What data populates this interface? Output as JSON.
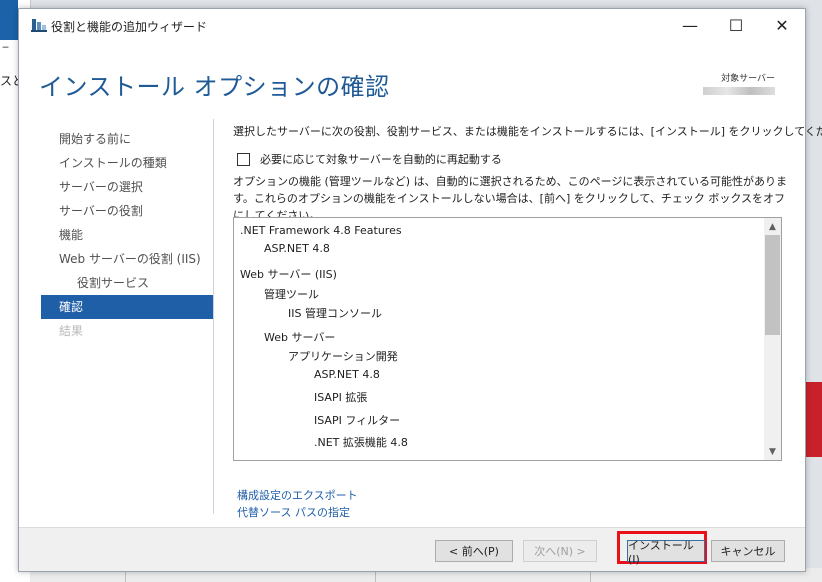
{
  "window": {
    "title": "役割と機能の追加ウィザード",
    "minimize": "—",
    "maximize": "☐",
    "close": "✕"
  },
  "background": {
    "left_fragment": "スと",
    "left_fragment2": "‒"
  },
  "header": {
    "title": "インストール オプションの確認",
    "target_server_label": "対象サーバー"
  },
  "nav": {
    "items": [
      {
        "label": "開始する前に",
        "state": "normal"
      },
      {
        "label": "インストールの種類",
        "state": "normal"
      },
      {
        "label": "サーバーの選択",
        "state": "normal"
      },
      {
        "label": "サーバーの役割",
        "state": "normal"
      },
      {
        "label": "機能",
        "state": "normal"
      },
      {
        "label": "Web サーバーの役割 (IIS)",
        "state": "normal"
      },
      {
        "label": "役割サービス",
        "state": "sub"
      },
      {
        "label": "確認",
        "state": "active"
      },
      {
        "label": "結果",
        "state": "disabled"
      }
    ]
  },
  "content": {
    "intro": "選択したサーバーに次の役割、役割サービス、または機能をインストールするには、[インストール] をクリックしてください。",
    "restart_label": "必要に応じて対象サーバーを自動的に再起動する",
    "optional_note": "オプションの機能 (管理ツールなど) は、自動的に選択されるため、このページに表示されている可能性があります。これらのオプションの機能をインストールしない場合は、[前へ] をクリックして、チェック ボックスをオフにしてください。",
    "features": [
      {
        "label": ".NET Framework 4.8 Features",
        "level": 0
      },
      {
        "label": "ASP.NET 4.8",
        "level": 1
      },
      {
        "label": "Web サーバー (IIS)",
        "level": 0
      },
      {
        "label": "管理ツール",
        "level": 1
      },
      {
        "label": "IIS 管理コンソール",
        "level": 2
      },
      {
        "label": "Web サーバー",
        "level": 1
      },
      {
        "label": "アプリケーション開発",
        "level": 2
      },
      {
        "label": "ASP.NET 4.8",
        "level": 3
      },
      {
        "label": "ISAPI 拡張",
        "level": 3
      },
      {
        "label": "ISAPI フィルター",
        "level": 3
      },
      {
        "label": ".NET 拡張機能 4.8",
        "level": 3
      }
    ],
    "export_link": "構成設定のエクスポート",
    "alt_source_link": "代替ソース パスの指定"
  },
  "footer": {
    "prev": "< 前へ(P)",
    "next": "次へ(N) >",
    "install": "インストール(I)",
    "cancel": "キャンセル"
  },
  "colors": {
    "accent": "#1f5fa8",
    "title": "#1d5a96",
    "highlight": "#e8101a"
  }
}
